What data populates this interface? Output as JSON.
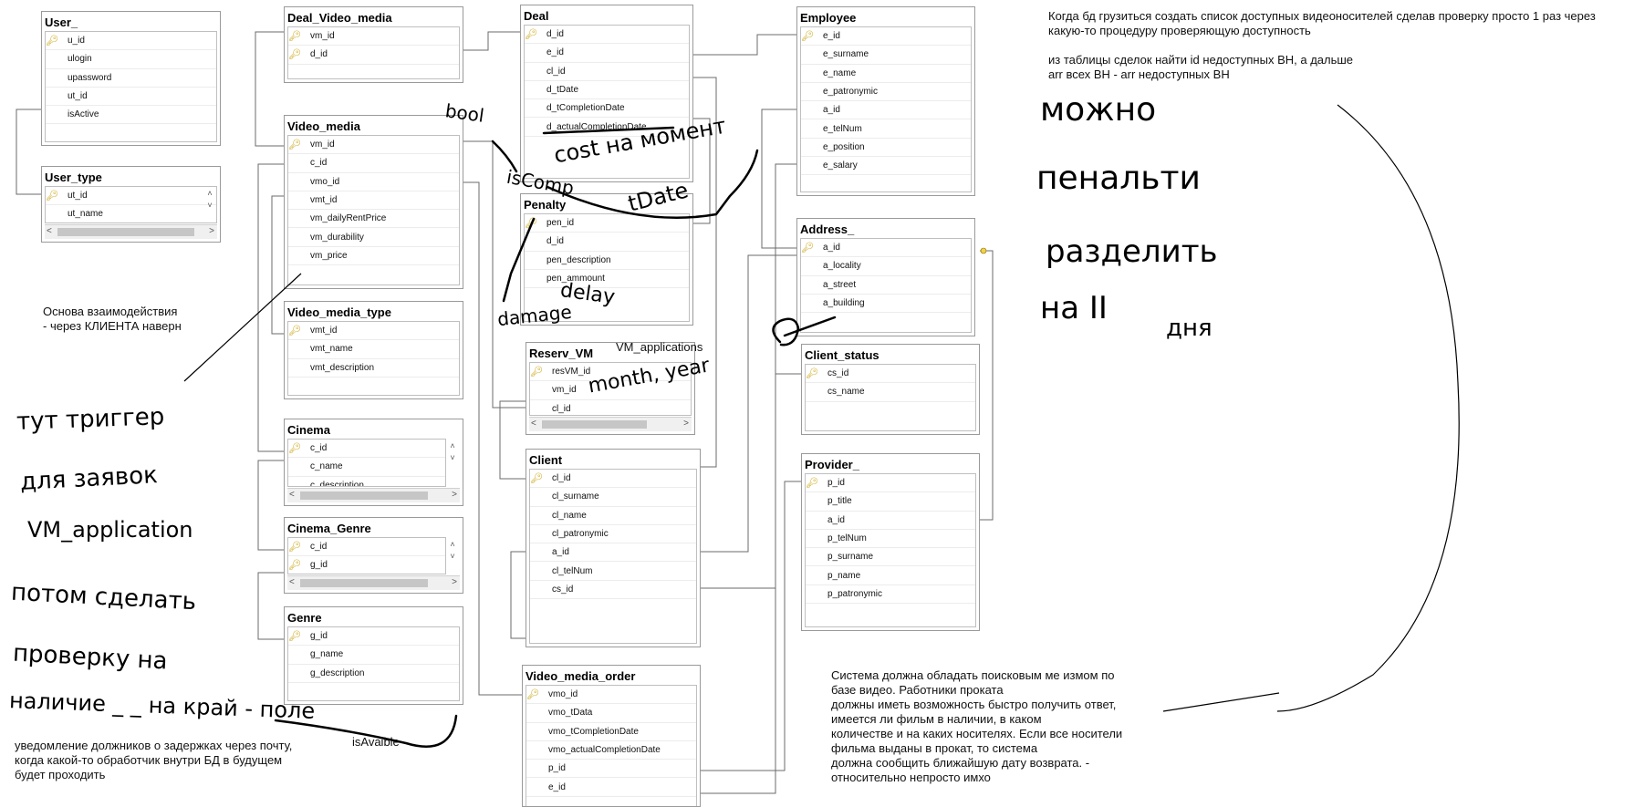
{
  "tables": {
    "user": {
      "title": "User_",
      "rows": [
        {
          "name": "u_id",
          "pk": true
        },
        {
          "name": "ulogin"
        },
        {
          "name": "upassword"
        },
        {
          "name": "ut_id"
        },
        {
          "name": "isActive"
        }
      ]
    },
    "user_type": {
      "title": "User_type",
      "rows": [
        {
          "name": "ut_id",
          "pk": true
        },
        {
          "name": "ut_name"
        }
      ]
    },
    "deal_video_media": {
      "title": "Deal_Video_media",
      "rows": [
        {
          "name": "vm_id",
          "pk": true
        },
        {
          "name": "d_id",
          "pk": true
        }
      ]
    },
    "video_media": {
      "title": "Video_media",
      "rows": [
        {
          "name": "vm_id",
          "pk": true
        },
        {
          "name": "c_id"
        },
        {
          "name": "vmo_id"
        },
        {
          "name": "vmt_id"
        },
        {
          "name": "vm_dailyRentPrice"
        },
        {
          "name": "vm_durability"
        },
        {
          "name": "vm_price"
        }
      ]
    },
    "video_media_type": {
      "title": "Video_media_type",
      "rows": [
        {
          "name": "vmt_id",
          "pk": true
        },
        {
          "name": "vmt_name"
        },
        {
          "name": "vmt_description"
        }
      ]
    },
    "cinema": {
      "title": "Cinema",
      "rows": [
        {
          "name": "c_id",
          "pk": true
        },
        {
          "name": "c_name"
        },
        {
          "name": "c_description"
        }
      ]
    },
    "cinema_genre": {
      "title": "Cinema_Genre",
      "rows": [
        {
          "name": "c_id",
          "pk": true
        },
        {
          "name": "g_id",
          "pk": true
        }
      ]
    },
    "genre": {
      "title": "Genre",
      "rows": [
        {
          "name": "g_id",
          "pk": true
        },
        {
          "name": "g_name"
        },
        {
          "name": "g_description"
        }
      ]
    },
    "deal": {
      "title": "Deal",
      "rows": [
        {
          "name": "d_id",
          "pk": true
        },
        {
          "name": "e_id"
        },
        {
          "name": "cl_id"
        },
        {
          "name": "d_tDate"
        },
        {
          "name": "d_tCompletionDate"
        },
        {
          "name": "d_actualCompletionDate"
        }
      ]
    },
    "penalty": {
      "title": "Penalty",
      "rows": [
        {
          "name": "pen_id",
          "pk": true
        },
        {
          "name": "d_id"
        },
        {
          "name": "pen_description"
        },
        {
          "name": "pen_ammount"
        }
      ]
    },
    "reserv_vm": {
      "title": "Reserv_VM",
      "rows": [
        {
          "name": "resVM_id",
          "pk": true
        },
        {
          "name": "vm_id"
        },
        {
          "name": "cl_id"
        }
      ]
    },
    "client": {
      "title": "Client",
      "rows": [
        {
          "name": "cl_id",
          "pk": true
        },
        {
          "name": "cl_surname"
        },
        {
          "name": "cl_name"
        },
        {
          "name": "cl_patronymic"
        },
        {
          "name": "a_id"
        },
        {
          "name": "cl_telNum"
        },
        {
          "name": "cs_id"
        }
      ]
    },
    "video_media_order": {
      "title": "Video_media_order",
      "rows": [
        {
          "name": "vmo_id",
          "pk": true
        },
        {
          "name": "vmo_tData"
        },
        {
          "name": "vmo_tCompletionDate"
        },
        {
          "name": "vmo_actualCompletionDate"
        },
        {
          "name": "p_id"
        },
        {
          "name": "e_id"
        }
      ]
    },
    "employee": {
      "title": "Employee",
      "rows": [
        {
          "name": "e_id",
          "pk": true
        },
        {
          "name": "e_surname"
        },
        {
          "name": "e_name"
        },
        {
          "name": "e_patronymic"
        },
        {
          "name": "a_id"
        },
        {
          "name": "e_telNum"
        },
        {
          "name": "e_position"
        },
        {
          "name": "e_salary"
        }
      ]
    },
    "address": {
      "title": "Address_",
      "rows": [
        {
          "name": "a_id",
          "pk": true
        },
        {
          "name": "a_locality"
        },
        {
          "name": "a_street"
        },
        {
          "name": "a_building"
        }
      ]
    },
    "client_status": {
      "title": "Client_status",
      "rows": [
        {
          "name": "cs_id",
          "pk": true
        },
        {
          "name": "cs_name"
        }
      ]
    },
    "provider": {
      "title": "Provider_",
      "rows": [
        {
          "name": "p_id",
          "pk": true
        },
        {
          "name": "p_title"
        },
        {
          "name": "a_id"
        },
        {
          "name": "p_telNum"
        },
        {
          "name": "p_surname"
        },
        {
          "name": "p_name"
        },
        {
          "name": "p_patronymic"
        }
      ]
    }
  },
  "notes": {
    "top_right": "Когда бд грузиться создать список доступных видеоносителей сделав проверку просто 1 раз через какую-то процедуру проверяющую  доступность\n\nиз таблицы сделок найти id недоступных ВН, а дальше\narr всех ВН - arr недоступных ВН",
    "interaction": "Основа взаимодействия\n- через КЛИЕНТА наверн",
    "vm_applications": "VM_applications",
    "notification": "уведомление должников о задержках через почту,\nкогда какой-то обработчик внутри БД в будущем\nбудет проходить",
    "is_available": "isAvaible",
    "system_requirement": "Система должна обладать поисковым ме   измом по\nбазе видео. Работники проката\nдолжны иметь возможность быстро получить ответ,\nимеется ли фильм в наличии, в каком\nколичестве и на каких носителях. Если все носители\nфильма выданы в прокат, то система\nдолжна сообщить ближайшую дату возврата. -\nотносительно непросто имхо"
  },
  "handwriting": {
    "bool": "bool",
    "cost_per_minute": "cost  на момент",
    "is_comp": "isComp",
    "t_date": "tDate",
    "delay": "delay",
    "damage": "damage",
    "month_year": "month, year",
    "left_block": [
      "тут триггер",
      "для заявок",
      "VM_application",
      "потом сделать",
      "проверку на",
      "наличие  _ _ на край - поле"
    ],
    "right_block": [
      "можно",
      "пенальти",
      "разделить",
      "на II",
      "дня"
    ]
  }
}
